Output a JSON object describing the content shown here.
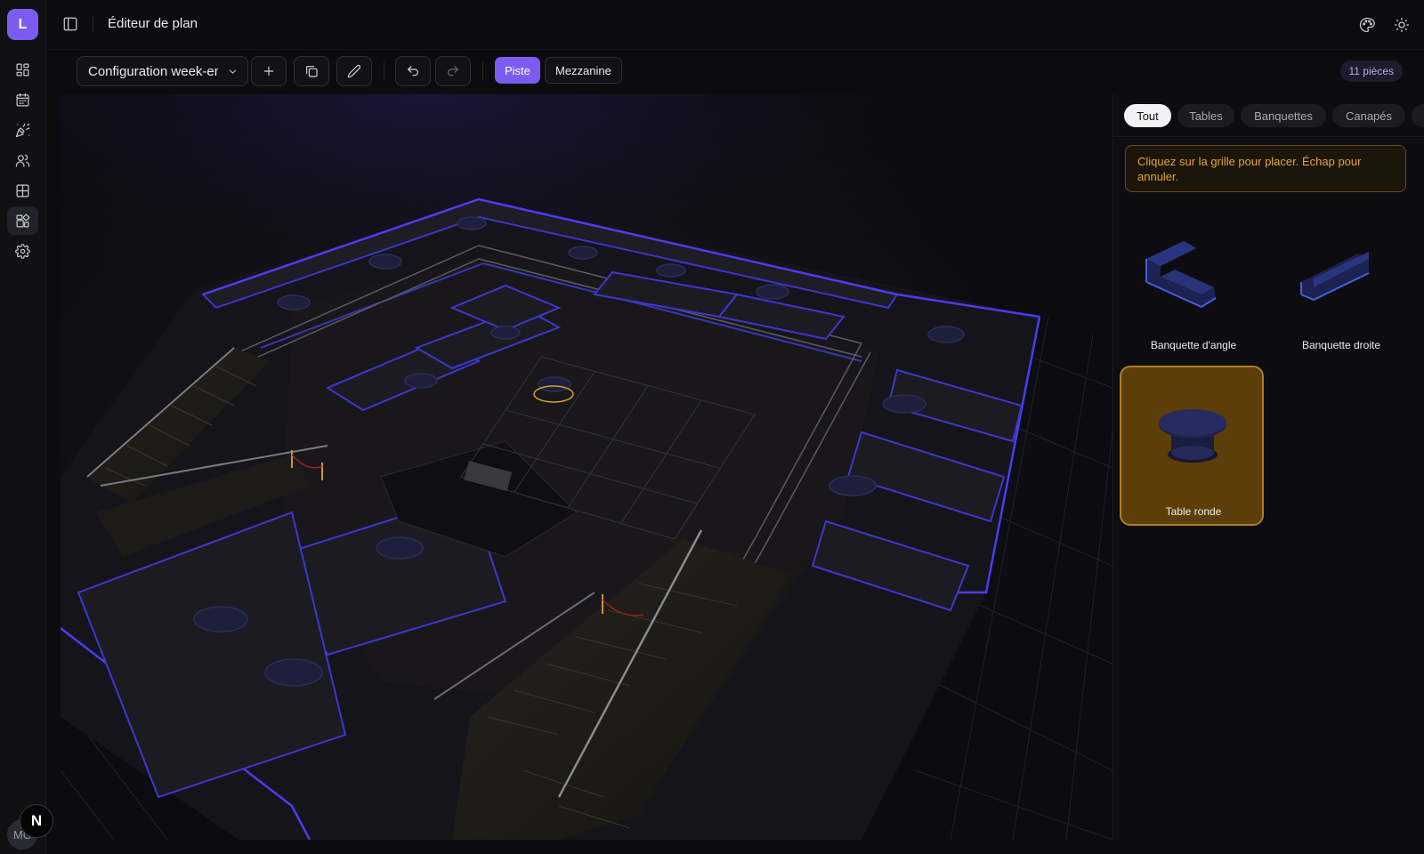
{
  "app": {
    "logo_letter": "L",
    "page_title": "Éditeur de plan",
    "user_initials": "MC",
    "corner_badge": "N"
  },
  "rail": {
    "items": [
      {
        "icon": "dashboard-icon"
      },
      {
        "icon": "calendar-icon"
      },
      {
        "icon": "party-popper-icon"
      },
      {
        "icon": "users-icon"
      },
      {
        "icon": "grid-icon"
      },
      {
        "icon": "floor-plan-icon",
        "active": true
      },
      {
        "icon": "gear-icon"
      }
    ]
  },
  "header": {
    "icons": [
      "palette-icon",
      "sun-icon"
    ]
  },
  "toolbar": {
    "config_value": "Configuration week-end",
    "buttons": [
      "plus-icon",
      "duplicate-icon",
      "pencil-icon",
      "undo-icon",
      "redo-icon"
    ],
    "floors": [
      {
        "label": "Piste",
        "active": true
      },
      {
        "label": "Mezzanine",
        "active": false
      }
    ],
    "piece_count": "11 pièces"
  },
  "panel": {
    "tabs": [
      {
        "label": "Tout",
        "active": true
      },
      {
        "label": "Tables",
        "active": false
      },
      {
        "label": "Banquettes",
        "active": false
      },
      {
        "label": "Canapés",
        "active": false
      }
    ],
    "hint": "Cliquez sur la grille pour placer. Échap pour annuler.",
    "pieces": [
      {
        "label": "Banquette d'angle",
        "selected": false
      },
      {
        "label": "Banquette droite",
        "selected": false
      },
      {
        "label": "Table ronde",
        "selected": true
      }
    ]
  },
  "colors": {
    "accent": "#7c5cf0",
    "selected_piece_bg": "#5b3e08",
    "hint_text": "#e6a43a",
    "neon_edge": "#4a3df0"
  }
}
